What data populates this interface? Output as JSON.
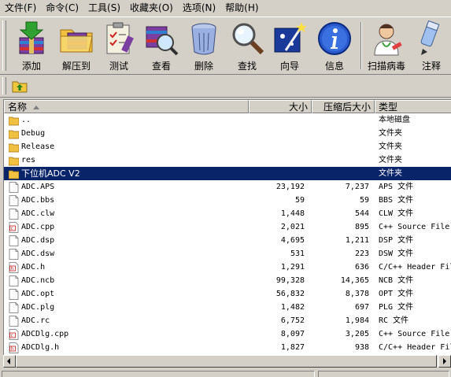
{
  "menu": [
    "文件(F)",
    "命令(C)",
    "工具(S)",
    "收藏夹(O)",
    "选项(N)",
    "帮助(H)"
  ],
  "toolbar": {
    "add": "添加",
    "extract": "解压到",
    "test": "测试",
    "view": "查看",
    "delete": "删除",
    "find": "查找",
    "wizard": "向导",
    "info": "信息",
    "scan": "扫描病毒",
    "comment": "注释"
  },
  "columns": {
    "name": "名称",
    "size": "大小",
    "packed": "压缩后大小",
    "type": "类型"
  },
  "files": [
    {
      "name": "..",
      "size": "",
      "packed": "",
      "type": "本地磁盘",
      "icon": "folder-icon"
    },
    {
      "name": "Debug",
      "size": "",
      "packed": "",
      "type": "文件夹",
      "icon": "folder-icon"
    },
    {
      "name": "Release",
      "size": "",
      "packed": "",
      "type": "文件夹",
      "icon": "folder-icon"
    },
    {
      "name": "res",
      "size": "",
      "packed": "",
      "type": "文件夹",
      "icon": "folder-icon"
    },
    {
      "name": "下位机ADC V2",
      "size": "",
      "packed": "",
      "type": "文件夹",
      "icon": "folder-icon",
      "selected": true
    },
    {
      "name": "ADC.APS",
      "size": "23,192",
      "packed": "7,237",
      "type": "APS 文件",
      "icon": "file-icon"
    },
    {
      "name": "ADC.bbs",
      "size": "59",
      "packed": "59",
      "type": "BBS 文件",
      "icon": "file-icon"
    },
    {
      "name": "ADC.clw",
      "size": "1,448",
      "packed": "544",
      "type": "CLW 文件",
      "icon": "file-icon"
    },
    {
      "name": "ADC.cpp",
      "size": "2,021",
      "packed": "895",
      "type": "C++ Source File",
      "icon": "cpp-file-icon"
    },
    {
      "name": "ADC.dsp",
      "size": "4,695",
      "packed": "1,211",
      "type": "DSP 文件",
      "icon": "file-icon"
    },
    {
      "name": "ADC.dsw",
      "size": "531",
      "packed": "223",
      "type": "DSW 文件",
      "icon": "file-icon"
    },
    {
      "name": "ADC.h",
      "size": "1,291",
      "packed": "636",
      "type": "C/C++ Header File",
      "icon": "header-file-icon"
    },
    {
      "name": "ADC.ncb",
      "size": "99,328",
      "packed": "14,365",
      "type": "NCB 文件",
      "icon": "file-icon"
    },
    {
      "name": "ADC.opt",
      "size": "56,832",
      "packed": "8,378",
      "type": "OPT 文件",
      "icon": "file-icon"
    },
    {
      "name": "ADC.plg",
      "size": "1,482",
      "packed": "697",
      "type": "PLG 文件",
      "icon": "file-icon"
    },
    {
      "name": "ADC.rc",
      "size": "6,752",
      "packed": "1,984",
      "type": "RC 文件",
      "icon": "file-icon"
    },
    {
      "name": "ADCDlg.cpp",
      "size": "8,097",
      "packed": "3,205",
      "type": "C++ Source File",
      "icon": "cpp-file-icon"
    },
    {
      "name": "ADCDlg.h",
      "size": "1,827",
      "packed": "938",
      "type": "C/C++ Header File",
      "icon": "header-file-icon"
    }
  ],
  "colors": {
    "selection": "#0a246a",
    "folder": "#f0c040",
    "chrome": "#d4d0c8"
  }
}
